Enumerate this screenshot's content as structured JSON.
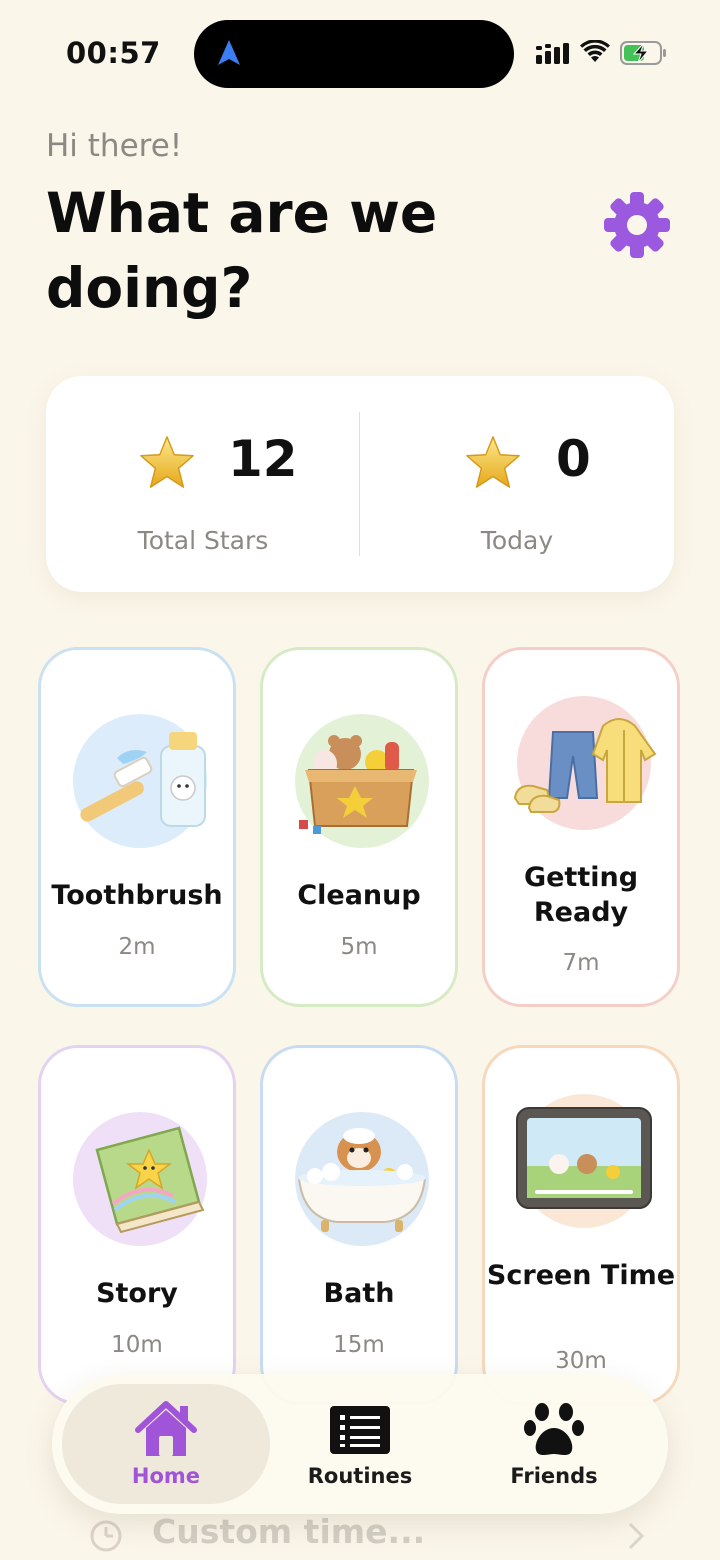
{
  "status_bar": {
    "time": "00:57"
  },
  "header": {
    "greeting": "Hi there!",
    "title": "What are we doing?"
  },
  "stats": {
    "total": {
      "value": "12",
      "label": "Total Stars"
    },
    "today": {
      "value": "0",
      "label": "Today"
    }
  },
  "routines": [
    {
      "title": "Toothbrush",
      "duration": "2m"
    },
    {
      "title": "Cleanup",
      "duration": "5m"
    },
    {
      "title": "Getting Ready",
      "duration": "7m"
    },
    {
      "title": "Story",
      "duration": "10m"
    },
    {
      "title": "Bath",
      "duration": "15m"
    },
    {
      "title": "Screen Time",
      "duration": "30m"
    }
  ],
  "nav": {
    "tabs": [
      {
        "label": "Home",
        "icon": "home-icon",
        "active": true
      },
      {
        "label": "Routines",
        "icon": "list-icon",
        "active": false
      },
      {
        "label": "Friends",
        "icon": "paw-icon",
        "active": false
      }
    ]
  },
  "custom_time": {
    "label": "Custom time..."
  },
  "colors": {
    "background": "#fbf6ea",
    "accent": "#a054d8",
    "card_borders": [
      "#c9e1f2",
      "#d6ebc5",
      "#f4cfc8",
      "#e3d2f0",
      "#c7dcf2",
      "#f6d8bd"
    ]
  }
}
